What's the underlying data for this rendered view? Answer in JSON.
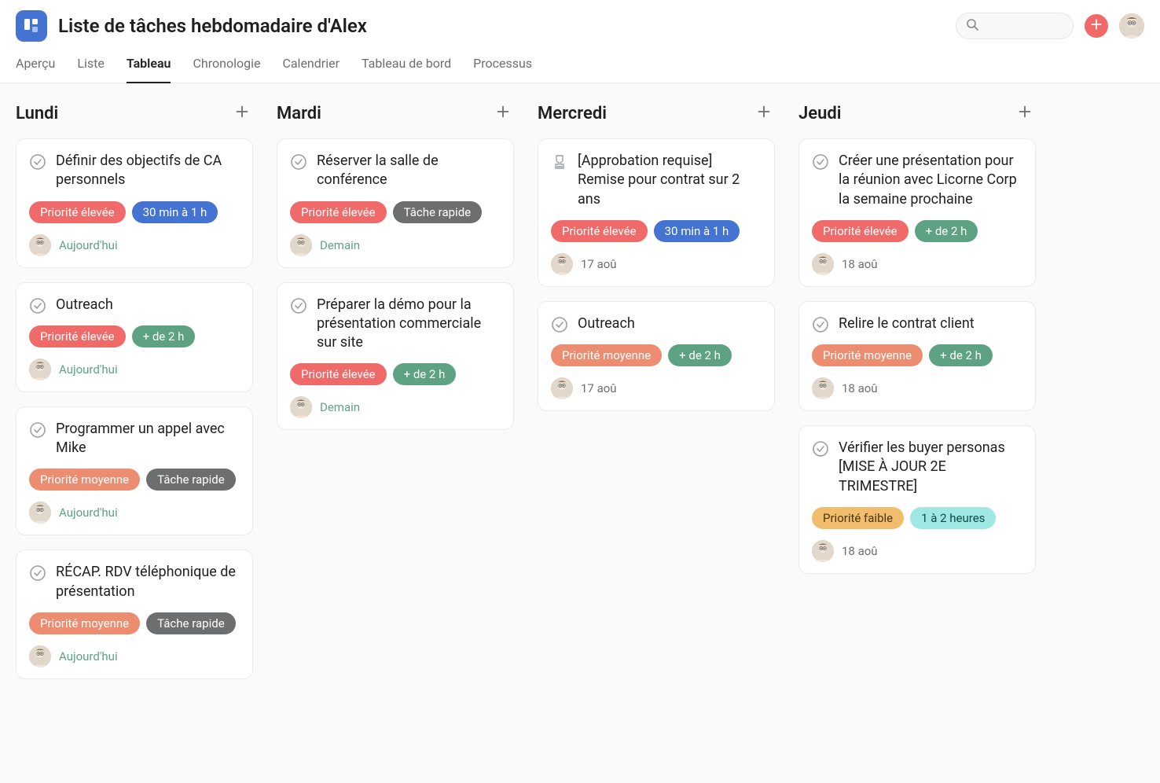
{
  "header": {
    "title": "Liste de tâches hebdomadaire d'Alex"
  },
  "tabs": {
    "items": [
      "Aperçu",
      "Liste",
      "Tableau",
      "Chronologie",
      "Calendrier",
      "Tableau de bord",
      "Processus"
    ],
    "active": 2
  },
  "tag_colors": {
    "priority_high": "tag-red",
    "priority_medium": "tag-orange",
    "priority_low": "tag-yellow",
    "time_30_1h": "tag-blue",
    "time_2h": "tag-teal",
    "time_1_2h": "tag-teal2",
    "quick_task": "tag-gray"
  },
  "columns": [
    {
      "name": "Lundi",
      "cards": [
        {
          "icon": "check",
          "title": "Définir des objectifs de CA personnels",
          "tags": [
            {
              "label": "Priorité élevée",
              "color": "priority_high"
            },
            {
              "label": "30 min à 1 h",
              "color": "time_30_1h"
            }
          ],
          "due": "Aujourd'hui",
          "due_style": "green"
        },
        {
          "icon": "check",
          "title": "Outreach",
          "tags": [
            {
              "label": "Priorité élevée",
              "color": "priority_high"
            },
            {
              "label": "+ de 2 h",
              "color": "time_2h"
            }
          ],
          "due": "Aujourd'hui",
          "due_style": "green"
        },
        {
          "icon": "check",
          "title": "Programmer un appel avec Mike",
          "tags": [
            {
              "label": "Priorité moyenne",
              "color": "priority_medium"
            },
            {
              "label": "Tâche rapide",
              "color": "quick_task"
            }
          ],
          "due": "Aujourd'hui",
          "due_style": "green"
        },
        {
          "icon": "check",
          "title": "RÉCAP. RDV téléphonique de présentation",
          "tags": [
            {
              "label": "Priorité moyenne",
              "color": "priority_medium"
            },
            {
              "label": "Tâche rapide",
              "color": "quick_task"
            }
          ],
          "due": "Aujourd'hui",
          "due_style": "green"
        }
      ]
    },
    {
      "name": "Mardi",
      "cards": [
        {
          "icon": "check",
          "title": "Réserver la salle de conférence",
          "tags": [
            {
              "label": "Priorité élevée",
              "color": "priority_high"
            },
            {
              "label": "Tâche rapide",
              "color": "quick_task"
            }
          ],
          "due": "Demain",
          "due_style": "green"
        },
        {
          "icon": "check",
          "title": "Préparer la démo pour la présentation commerciale sur site",
          "tags": [
            {
              "label": "Priorité élevée",
              "color": "priority_high"
            },
            {
              "label": "+ de 2 h",
              "color": "time_2h"
            }
          ],
          "due": "Demain",
          "due_style": "green"
        }
      ]
    },
    {
      "name": "Mercredi",
      "cards": [
        {
          "icon": "stamp",
          "title": "[Approbation requise] Remise pour contrat sur 2 ans",
          "tags": [
            {
              "label": "Priorité élevée",
              "color": "priority_high"
            },
            {
              "label": "30 min à 1 h",
              "color": "time_30_1h"
            }
          ],
          "due": "17 aoû",
          "due_style": "dim"
        },
        {
          "icon": "check",
          "title": "Outreach",
          "tags": [
            {
              "label": "Priorité moyenne",
              "color": "priority_medium"
            },
            {
              "label": "+ de 2 h",
              "color": "time_2h"
            }
          ],
          "due": "17 aoû",
          "due_style": "dim"
        }
      ]
    },
    {
      "name": "Jeudi",
      "cards": [
        {
          "icon": "check",
          "title": "Créer une présentation pour la réunion avec Licorne Corp la semaine prochaine",
          "tags": [
            {
              "label": "Priorité élevée",
              "color": "priority_high"
            },
            {
              "label": "+ de 2 h",
              "color": "time_2h"
            }
          ],
          "due": "18 aoû",
          "due_style": "dim"
        },
        {
          "icon": "check",
          "title": "Relire le contrat client",
          "tags": [
            {
              "label": "Priorité moyenne",
              "color": "priority_medium"
            },
            {
              "label": "+ de 2 h",
              "color": "time_2h"
            }
          ],
          "due": "18 aoû",
          "due_style": "dim"
        },
        {
          "icon": "check",
          "title": "Vérifier les buyer personas [MISE À JOUR 2E TRIMESTRE]",
          "tags": [
            {
              "label": "Priorité faible",
              "color": "priority_low"
            },
            {
              "label": "1 à 2 heures",
              "color": "time_1_2h"
            }
          ],
          "due": "18 aoû",
          "due_style": "dim"
        }
      ]
    }
  ]
}
